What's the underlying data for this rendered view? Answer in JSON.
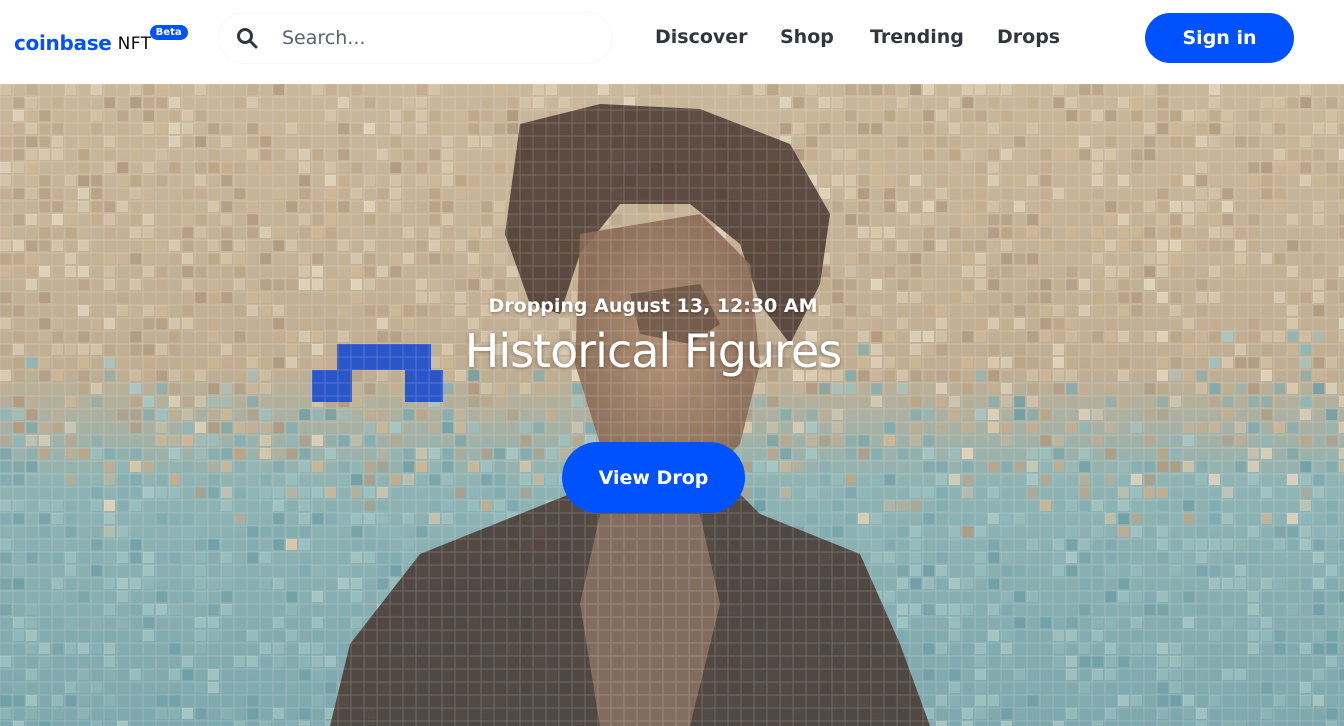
{
  "header": {
    "logo_word": "coinbase",
    "logo_suffix": "NFT",
    "beta_badge": "Beta",
    "search": {
      "placeholder": "Search..."
    },
    "nav": [
      "Discover",
      "Shop",
      "Trending",
      "Drops"
    ],
    "signin_label": "Sign in"
  },
  "hero": {
    "date_text": "Dropping August 13, 12:30 AM",
    "title": "Historical Figures",
    "cta_label": "View Drop"
  },
  "colors": {
    "brand_blue": "#0052ff",
    "nav_text": "#32353d",
    "hero_sand": "#c9b79a",
    "hero_teal": "#7ea8ad",
    "portrait_dark": "#3e2d26"
  },
  "icons": {
    "search": "search-icon"
  }
}
